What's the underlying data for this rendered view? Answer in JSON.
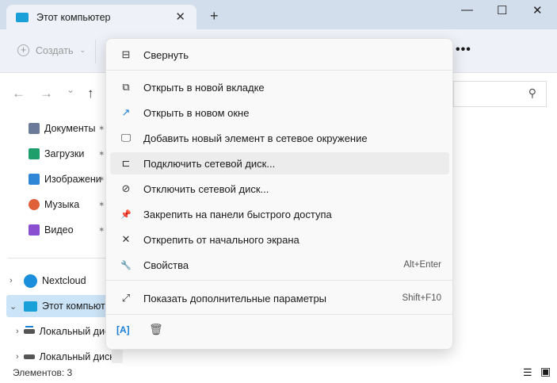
{
  "window": {
    "tab_title": "Этот компьютер",
    "new_tab": "+",
    "close_tab": "✕",
    "minimize": "—",
    "maximize": "☐",
    "close": "✕"
  },
  "toolbar": {
    "create_label": "Создать",
    "more": "•••"
  },
  "nav": {
    "back": "←",
    "forward": "→",
    "recent": "⌄",
    "up": "↑"
  },
  "quick_access": [
    {
      "label": "Документы",
      "color": "#6b7a99"
    },
    {
      "label": "Загрузки",
      "color": "#1e9e6a"
    },
    {
      "label": "Изображени",
      "color": "#2f86d6"
    },
    {
      "label": "Музыка",
      "color": "#e0603a"
    },
    {
      "label": "Видео",
      "color": "#8a4fd0"
    }
  ],
  "tree": [
    {
      "label": "Nextcloud",
      "chev": "›"
    },
    {
      "label": "Этот компьютер",
      "chev": "⌄"
    },
    {
      "label": "Локальный диск",
      "chev": "›"
    },
    {
      "label": "Локальный диск",
      "chev": "›"
    }
  ],
  "status": {
    "items": "Элементов: 3"
  },
  "context_menu": {
    "items": [
      {
        "label": "Свернуть",
        "icon": "collapse-icon",
        "glyph": "⊟"
      },
      {
        "label": "Открыть в новой вкладке",
        "icon": "new-tab-icon",
        "glyph": "⧉"
      },
      {
        "label": "Открыть в новом окне",
        "icon": "new-window-icon",
        "glyph": "↗"
      },
      {
        "label": "Добавить новый элемент в сетевое окружение",
        "icon": "network-location-icon",
        "glyph": "🖵"
      },
      {
        "label": "Подключить сетевой диск...",
        "icon": "map-drive-icon",
        "glyph": "⊏"
      },
      {
        "label": "Отключить сетевой диск...",
        "icon": "disconnect-drive-icon",
        "glyph": "⊘"
      },
      {
        "label": "Закрепить на панели быстрого доступа",
        "icon": "pin-icon",
        "glyph": "📌"
      },
      {
        "label": "Открепить от начального экрана",
        "icon": "unpin-icon",
        "glyph": "✕"
      },
      {
        "label": "Свойства",
        "icon": "wrench-icon",
        "glyph": "🔧",
        "shortcut": "Alt+Enter"
      },
      {
        "label": "Показать дополнительные параметры",
        "icon": "more-options-icon",
        "glyph": "⤢",
        "shortcut": "Shift+F10"
      }
    ],
    "rename_glyph": "[A]",
    "delete_glyph": "🗑"
  }
}
